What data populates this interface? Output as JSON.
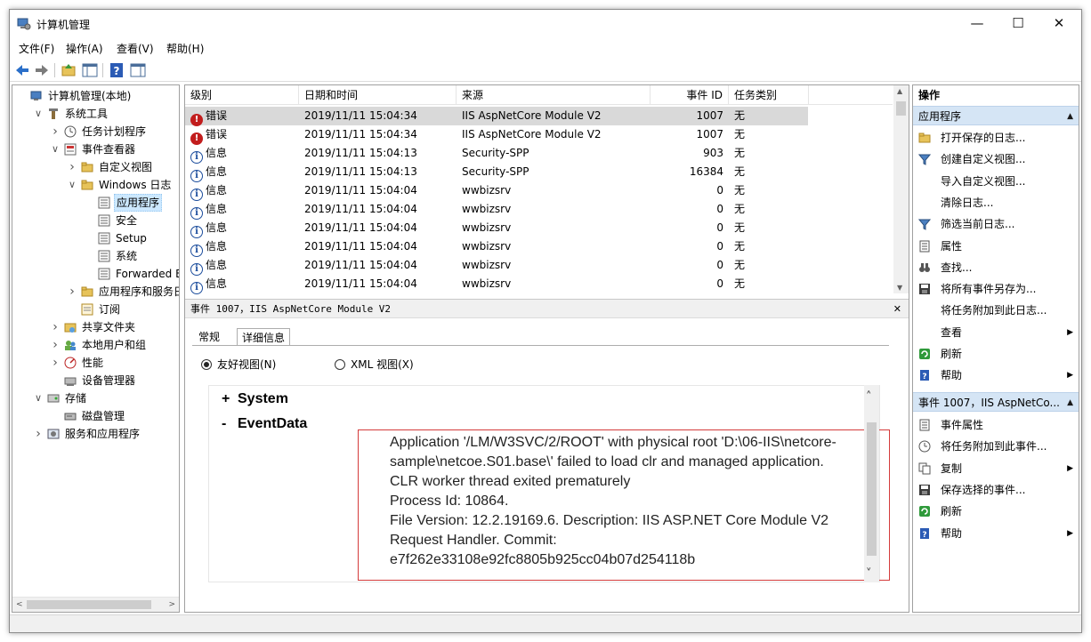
{
  "window": {
    "title": "计算机管理"
  },
  "menu": [
    "文件(F)",
    "操作(A)",
    "查看(V)",
    "帮助(H)"
  ],
  "tree": [
    {
      "label": "计算机管理(本地)",
      "indent": 0,
      "exp": ""
    },
    {
      "label": "系统工具",
      "indent": 1,
      "exp": "v"
    },
    {
      "label": "任务计划程序",
      "indent": 2,
      "exp": ">"
    },
    {
      "label": "事件查看器",
      "indent": 2,
      "exp": "v"
    },
    {
      "label": "自定义视图",
      "indent": 3,
      "exp": ">"
    },
    {
      "label": "Windows 日志",
      "indent": 3,
      "exp": "v"
    },
    {
      "label": "应用程序",
      "indent": 4,
      "exp": "",
      "selected": true
    },
    {
      "label": "安全",
      "indent": 4,
      "exp": ""
    },
    {
      "label": "Setup",
      "indent": 4,
      "exp": ""
    },
    {
      "label": "系统",
      "indent": 4,
      "exp": ""
    },
    {
      "label": "Forwarded Eve",
      "indent": 4,
      "exp": ""
    },
    {
      "label": "应用程序和服务日志",
      "indent": 3,
      "exp": ">"
    },
    {
      "label": "订阅",
      "indent": 3,
      "exp": ""
    },
    {
      "label": "共享文件夹",
      "indent": 2,
      "exp": ">"
    },
    {
      "label": "本地用户和组",
      "indent": 2,
      "exp": ">"
    },
    {
      "label": "性能",
      "indent": 2,
      "exp": ">"
    },
    {
      "label": "设备管理器",
      "indent": 2,
      "exp": ""
    },
    {
      "label": "存储",
      "indent": 1,
      "exp": "v"
    },
    {
      "label": "磁盘管理",
      "indent": 2,
      "exp": ""
    },
    {
      "label": "服务和应用程序",
      "indent": 1,
      "exp": ">"
    }
  ],
  "events": {
    "columns": [
      "级别",
      "日期和时间",
      "来源",
      "事件 ID",
      "任务类别"
    ],
    "rows": [
      {
        "level": "错误",
        "type": "error",
        "datetime": "2019/11/11 15:04:34",
        "source": "IIS AspNetCore Module V2",
        "id": "1007",
        "category": "无",
        "selected": true
      },
      {
        "level": "错误",
        "type": "error",
        "datetime": "2019/11/11 15:04:34",
        "source": "IIS AspNetCore Module V2",
        "id": "1007",
        "category": "无"
      },
      {
        "level": "信息",
        "type": "info",
        "datetime": "2019/11/11 15:04:13",
        "source": "Security-SPP",
        "id": "903",
        "category": "无"
      },
      {
        "level": "信息",
        "type": "info",
        "datetime": "2019/11/11 15:04:13",
        "source": "Security-SPP",
        "id": "16384",
        "category": "无"
      },
      {
        "level": "信息",
        "type": "info",
        "datetime": "2019/11/11 15:04:04",
        "source": "wwbizsrv",
        "id": "0",
        "category": "无"
      },
      {
        "level": "信息",
        "type": "info",
        "datetime": "2019/11/11 15:04:04",
        "source": "wwbizsrv",
        "id": "0",
        "category": "无"
      },
      {
        "level": "信息",
        "type": "info",
        "datetime": "2019/11/11 15:04:04",
        "source": "wwbizsrv",
        "id": "0",
        "category": "无"
      },
      {
        "level": "信息",
        "type": "info",
        "datetime": "2019/11/11 15:04:04",
        "source": "wwbizsrv",
        "id": "0",
        "category": "无"
      },
      {
        "level": "信息",
        "type": "info",
        "datetime": "2019/11/11 15:04:04",
        "source": "wwbizsrv",
        "id": "0",
        "category": "无"
      },
      {
        "level": "信息",
        "type": "info",
        "datetime": "2019/11/11 15:04:04",
        "source": "wwbizsrv",
        "id": "0",
        "category": "无"
      }
    ]
  },
  "detail": {
    "title": "事件 1007，IIS AspNetCore Module V2",
    "tabs": [
      "常规",
      "详细信息"
    ],
    "radio_friendly": "友好视图(N)",
    "radio_xml": "XML 视图(X)",
    "system_node": "System",
    "eventdata_node": "EventData",
    "plus": "+",
    "minus": "-",
    "message_lines": [
      "Application '/LM/W3SVC/2/ROOT' with physical root 'D:\\06-IIS\\netcore-",
      "sample\\netcoe.S01.base\\' failed to load clr and managed application.",
      "CLR worker thread exited prematurely",
      "Process Id: 10864.",
      "File Version: 12.2.19169.6. Description: IIS ASP.NET Core Module V2",
      "Request Handler. Commit:",
      "e7f262e33108e92fc8805b925cc04b07d254118b"
    ]
  },
  "actions": {
    "header": "操作",
    "section1": "应用程序",
    "items1": [
      {
        "label": "打开保存的日志...",
        "icon": "folder-icon",
        "arrow": false
      },
      {
        "label": "创建自定义视图...",
        "icon": "filter-icon",
        "arrow": false
      },
      {
        "label": "导入自定义视图...",
        "icon": "",
        "arrow": false
      },
      {
        "label": "清除日志...",
        "icon": "",
        "arrow": false
      },
      {
        "label": "筛选当前日志...",
        "icon": "filter-icon",
        "arrow": false
      },
      {
        "label": "属性",
        "icon": "properties-icon",
        "arrow": false
      },
      {
        "label": "查找...",
        "icon": "binoculars-icon",
        "arrow": false
      },
      {
        "label": "将所有事件另存为...",
        "icon": "save-icon",
        "arrow": false
      },
      {
        "label": "将任务附加到此日志...",
        "icon": "",
        "arrow": false
      },
      {
        "label": "查看",
        "icon": "",
        "arrow": true
      },
      {
        "label": "刷新",
        "icon": "refresh-icon",
        "arrow": false
      },
      {
        "label": "帮助",
        "icon": "help-icon",
        "arrow": true
      }
    ],
    "section2": "事件 1007，IIS AspNetCo...",
    "items2": [
      {
        "label": "事件属性",
        "icon": "properties-icon",
        "arrow": false
      },
      {
        "label": "将任务附加到此事件...",
        "icon": "task-icon",
        "arrow": false
      },
      {
        "label": "复制",
        "icon": "copy-icon",
        "arrow": true
      },
      {
        "label": "保存选择的事件...",
        "icon": "save-icon",
        "arrow": false
      },
      {
        "label": "刷新",
        "icon": "refresh-icon",
        "arrow": false
      },
      {
        "label": "帮助",
        "icon": "help-icon",
        "arrow": true
      }
    ]
  }
}
